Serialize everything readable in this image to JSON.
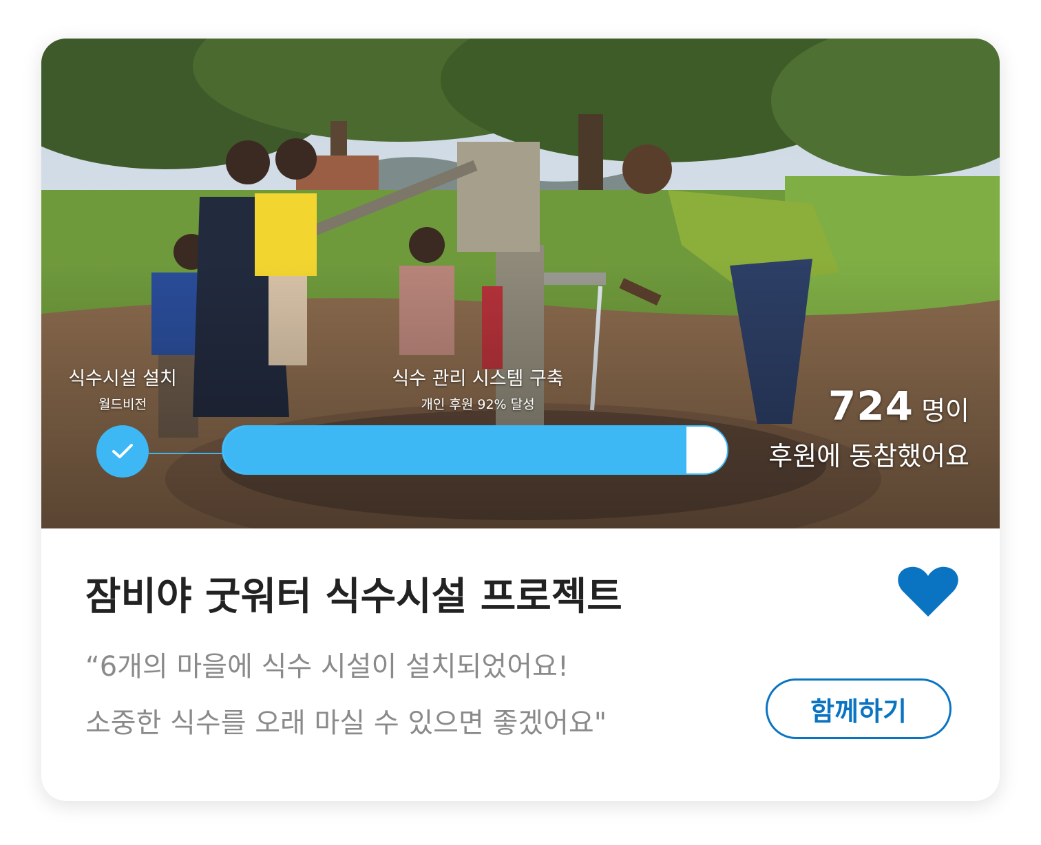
{
  "hero": {
    "steps": [
      {
        "title": "식수시설 설치",
        "subtitle": "월드비전",
        "status": "completed"
      },
      {
        "title": "식수 관리 시스템 구축",
        "subtitle": "개인 후원 92% 달성",
        "status": "in-progress"
      }
    ],
    "progress_fraction": 0.92,
    "supporters": {
      "count": "724",
      "unit": "명이",
      "caption": "후원에 동참했어요"
    }
  },
  "project": {
    "title": "잠비야 굿워터 식수시설 프로젝트",
    "quote_line1": "“6개의 마을에 식수 시설이 설치되었어요!",
    "quote_line2": "소중한 식수를 오래 마실 수 있으면 좋겠어요\"",
    "favorite_icon": "heart-icon",
    "join_label": "함께하기"
  },
  "colors": {
    "progress": "#3db8f5",
    "accent": "#0a74c2",
    "title": "#222222",
    "quote": "#8a8a8a"
  }
}
